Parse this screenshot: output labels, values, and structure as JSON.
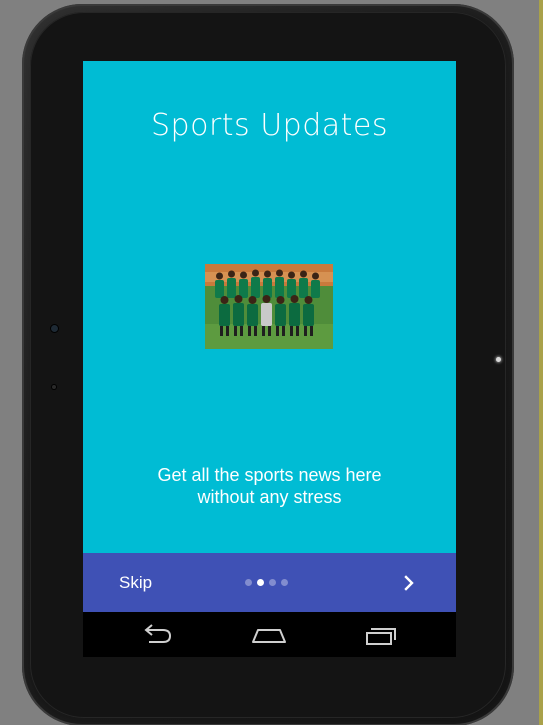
{
  "screen": {
    "title": "Sports Updates",
    "image_icon": "team-photo",
    "description_line1": "Get all the sports news here",
    "description_line2": "without any stress"
  },
  "bottom_bar": {
    "skip_label": "Skip",
    "page_count": 4,
    "active_page": 2,
    "next_icon": "chevron-right-icon"
  },
  "nav": {
    "back_icon": "back-icon",
    "home_icon": "home-icon",
    "recents_icon": "recents-icon"
  },
  "colors": {
    "screen_bg": "#00bcd4",
    "bottom_bar_bg": "#3f51b5",
    "nav_bg": "#000000",
    "text": "#ffffff"
  }
}
